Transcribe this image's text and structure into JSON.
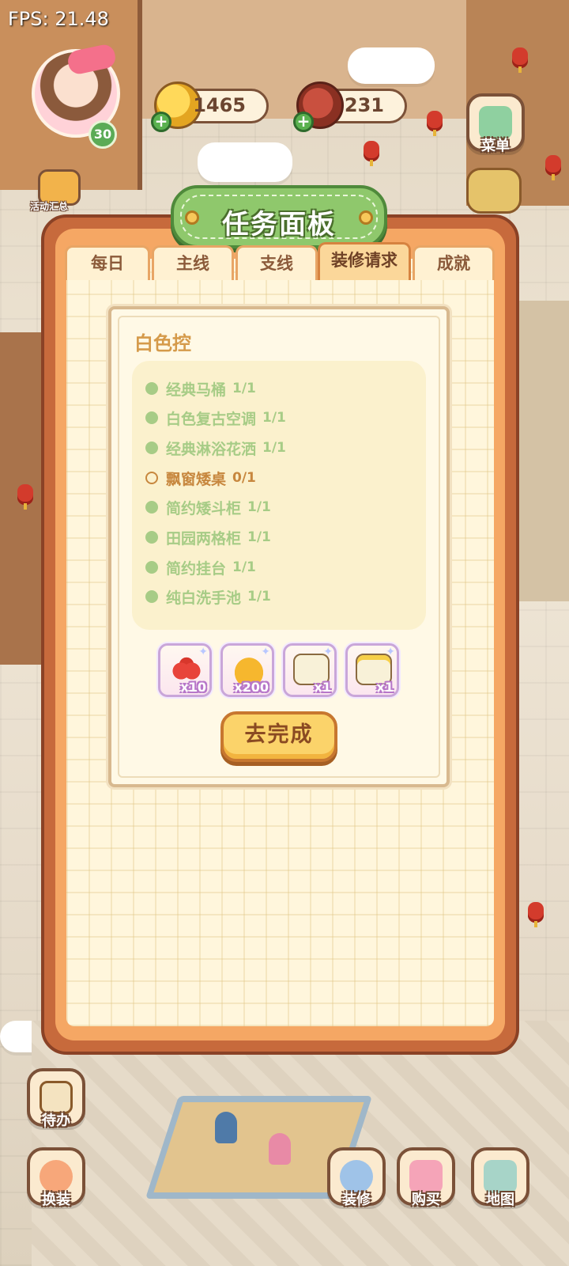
{
  "hud": {
    "fps": "FPS: 21.48",
    "level": "30",
    "coins": "1465",
    "meat": "231"
  },
  "side_menu": {
    "activity_summary": "活动汇总",
    "menu": "菜单",
    "todo": "待办",
    "dress_up": "换装",
    "decorate": "装修",
    "buy": "购买",
    "map": "地图"
  },
  "panel": {
    "title": "任务面板",
    "tabs": [
      {
        "label": "每日",
        "active": false
      },
      {
        "label": "主线",
        "active": false
      },
      {
        "label": "支线",
        "active": false
      },
      {
        "label": "装修请求",
        "active": true
      },
      {
        "label": "成就",
        "active": false
      }
    ],
    "task": {
      "title": "白色控",
      "requirements": [
        {
          "name": "经典马桶",
          "progress": "1/1",
          "done": true
        },
        {
          "name": "白色复古空调",
          "progress": "1/1",
          "done": true
        },
        {
          "name": "经典淋浴花洒",
          "progress": "1/1",
          "done": true
        },
        {
          "name": "飘窗矮桌",
          "progress": "0/1",
          "done": false
        },
        {
          "name": "简约矮斗柜",
          "progress": "1/1",
          "done": true
        },
        {
          "name": "田园两格柜",
          "progress": "1/1",
          "done": true
        },
        {
          "name": "简约挂台",
          "progress": "1/1",
          "done": true
        },
        {
          "name": "纯白洗手池",
          "progress": "1/1",
          "done": true
        }
      ],
      "rewards": [
        {
          "icon": "tomato-icon",
          "count": "x10"
        },
        {
          "icon": "gold-pile-icon",
          "count": "x200"
        },
        {
          "icon": "sprout-box-icon",
          "count": "x1"
        },
        {
          "icon": "crowned-box-icon",
          "count": "x1"
        }
      ],
      "action_label": "去完成"
    }
  },
  "colors": {
    "panel_frame": "#c76a3c",
    "panel_rim": "#f5a764",
    "title_green": "#8fc86c",
    "done_green": "#a7cc86",
    "todo_orange": "#c7873e",
    "button_yellow": "#fbd36a"
  }
}
